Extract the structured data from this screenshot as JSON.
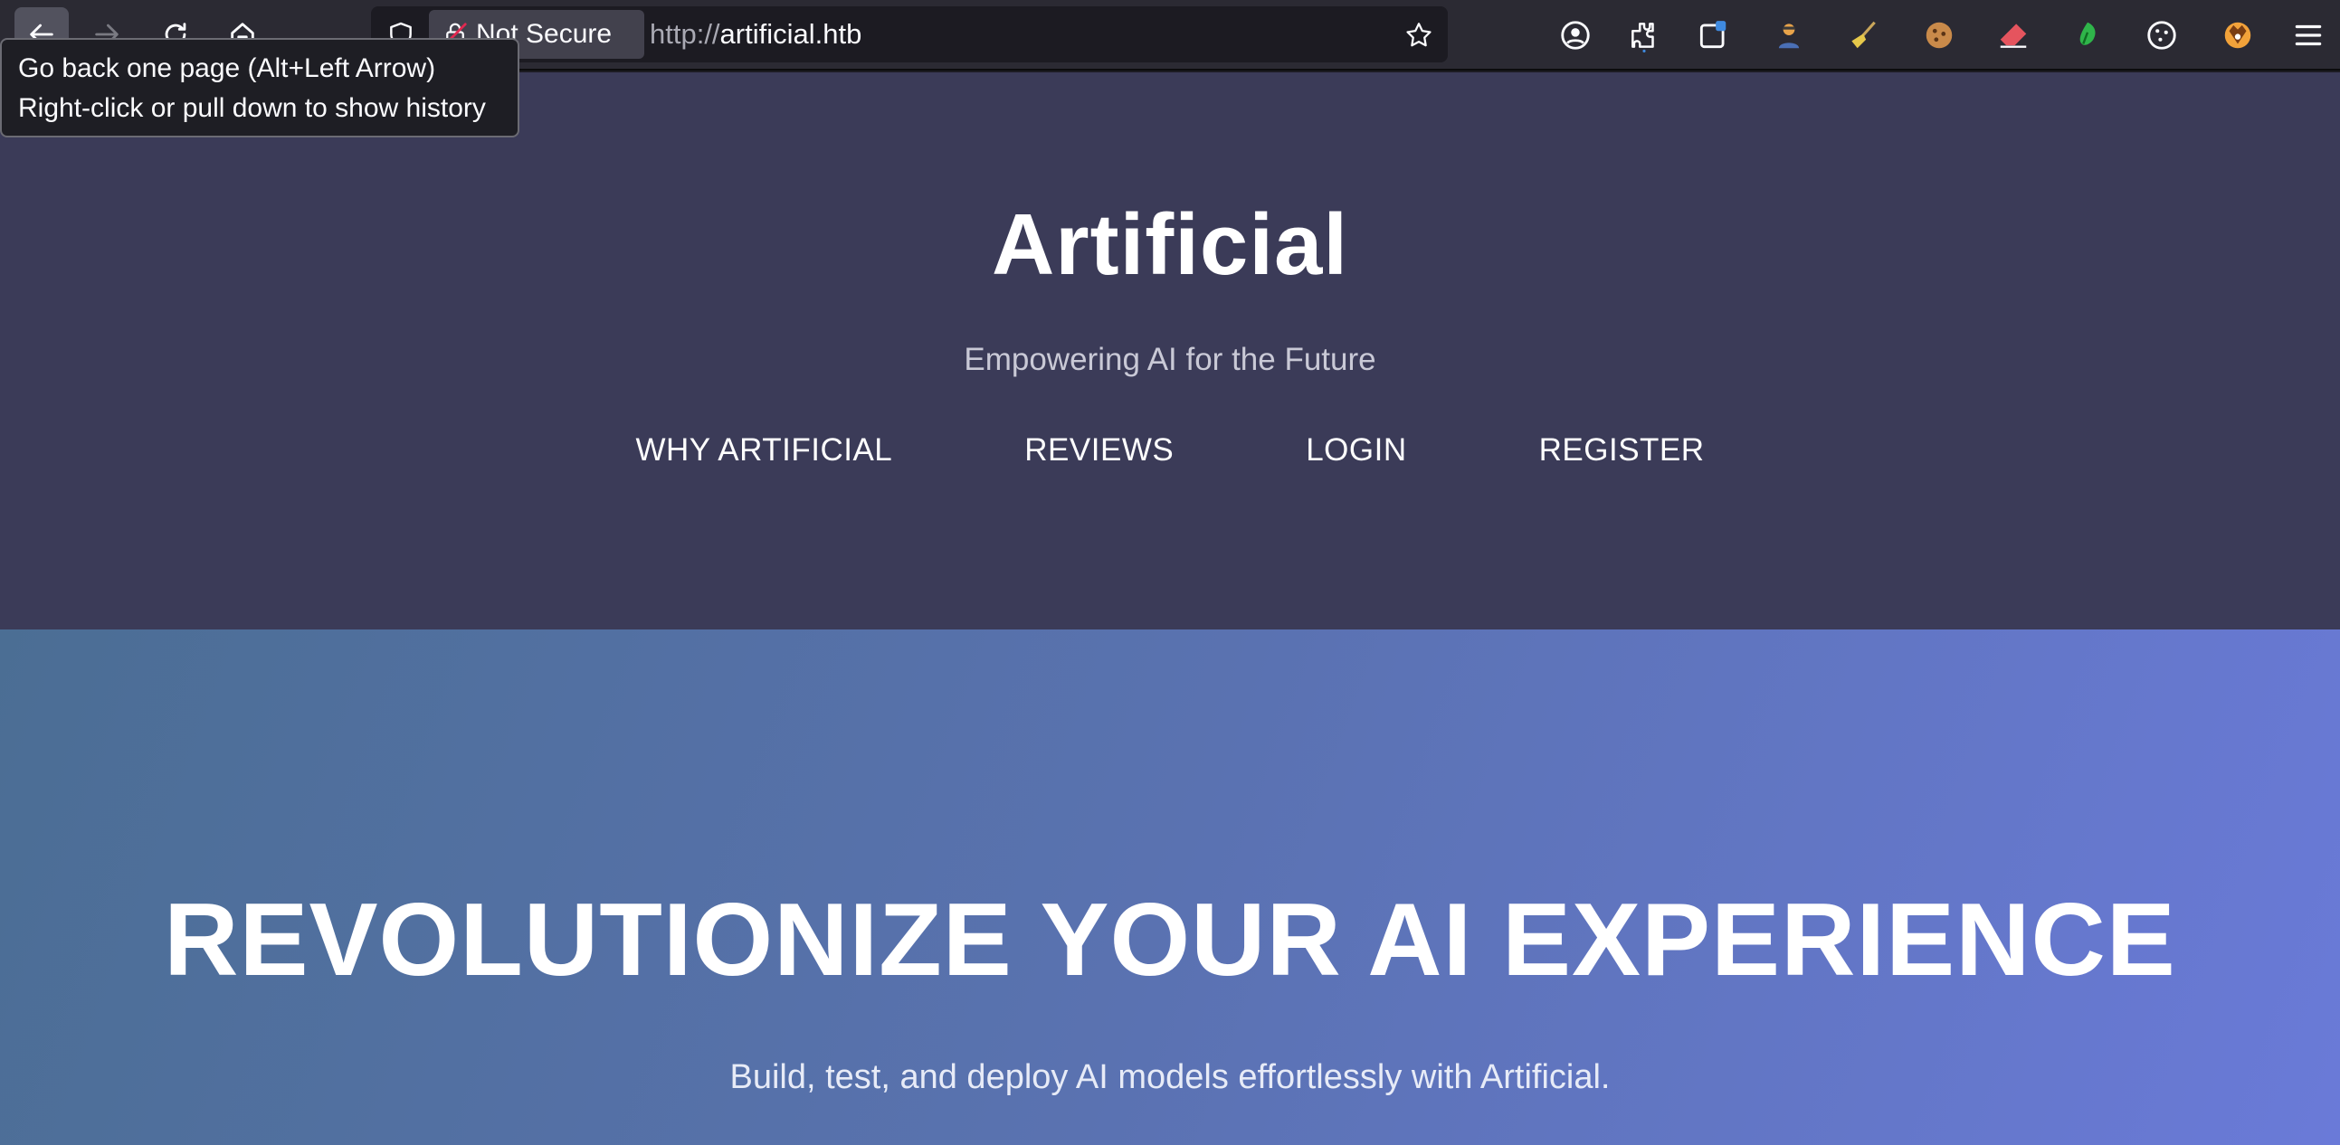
{
  "browser": {
    "nav": {
      "back_icon": "arrow-left-icon",
      "forward_icon": "arrow-right-icon",
      "reload_icon": "reload-icon",
      "home_icon": "home-icon"
    },
    "urlbar": {
      "security_label": "Not Secure",
      "url_protocol": "http://",
      "url_host": "artificial.htb"
    },
    "tooltip": {
      "line1": "Go back one page (Alt+Left Arrow)",
      "line2": "Right-click or pull down to show history"
    },
    "extensions": [
      "account-icon",
      "puzzle-icon",
      "container-icon",
      "agent-icon",
      "broom-icon",
      "cookie-icon",
      "eraser-icon",
      "leaf-icon",
      "cookie-outline-icon",
      "fox-icon",
      "menu-icon"
    ]
  },
  "site": {
    "title": "Artificial",
    "tagline": "Empowering AI for the Future",
    "nav": [
      "WHY ARTIFICIAL",
      "REVIEWS",
      "LOGIN",
      "REGISTER"
    ]
  },
  "hero": {
    "title": "REVOLUTIONIZE YOUR AI EXPERIENCE",
    "subtitle": "Build, test, and deploy AI models effortlessly with Artificial."
  },
  "colors": {
    "header_bg": "#3b3b58",
    "hero_gradient_start": "#4b6e94",
    "hero_gradient_end": "#6a7ad8",
    "toolbar_bg": "#2b2a33"
  }
}
